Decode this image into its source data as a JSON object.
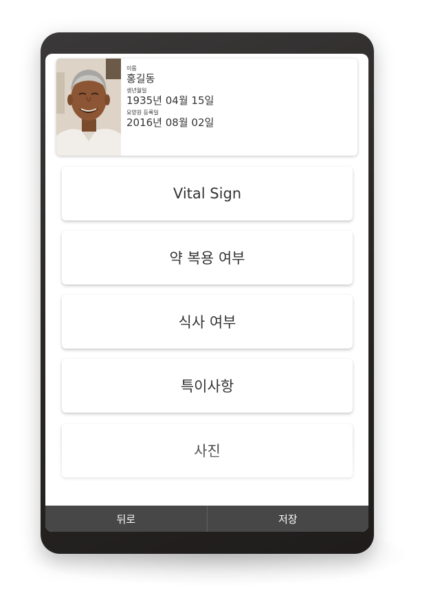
{
  "profile": {
    "name_label": "이름",
    "name": "홍길동",
    "birth_label": "생년월일",
    "birth": "1935년 04월 15일",
    "reg_label": "요양원 등록일",
    "reg": "2016년 08월 02일"
  },
  "menu": [
    {
      "label": "Vital Sign"
    },
    {
      "label": "약 복용 여부"
    },
    {
      "label": "식사 여부"
    },
    {
      "label": "특이사항"
    },
    {
      "label": "사진"
    }
  ],
  "bottom": {
    "back_label": "뒤로",
    "save_label": "저장"
  },
  "colors": {
    "device_frame": "#2b2727",
    "bottom_bar": "#474747",
    "text": "#333333"
  }
}
